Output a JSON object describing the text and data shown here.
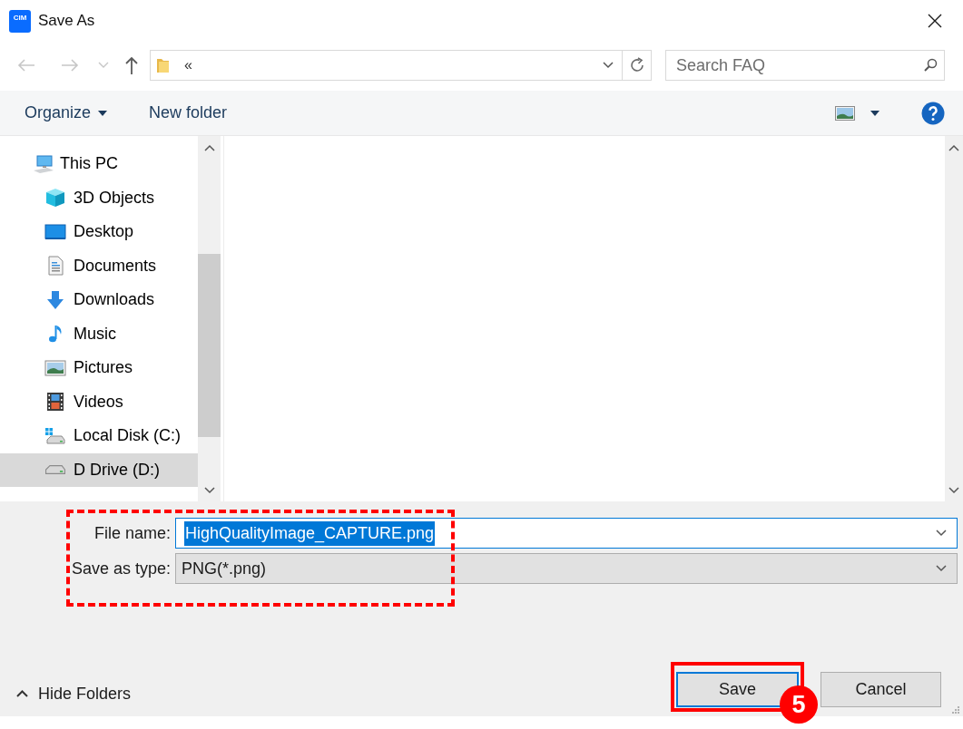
{
  "window": {
    "app_icon_text": "CIM",
    "title": "Save As"
  },
  "nav_buttons": [
    {
      "kind": "back",
      "disabled": true
    },
    {
      "kind": "forward",
      "disabled": true
    },
    {
      "kind": "recent",
      "disabled": true
    },
    {
      "kind": "up",
      "disabled": false
    }
  ],
  "address_bar": {
    "path": "«"
  },
  "search": {
    "placeholder": "Search FAQ"
  },
  "toolbar": {
    "organize": "Organize",
    "new_folder": "New folder"
  },
  "sidebar": {
    "items": [
      {
        "label": "This PC",
        "kind": "pc",
        "selected": false,
        "children": [
          {
            "label": "3D Objects",
            "kind": "objects3d",
            "selected": false
          },
          {
            "label": "Desktop",
            "kind": "desktop",
            "selected": false
          },
          {
            "label": "Documents",
            "kind": "documents",
            "selected": false
          },
          {
            "label": "Downloads",
            "kind": "downloads",
            "selected": false
          },
          {
            "label": "Music",
            "kind": "music",
            "selected": false
          },
          {
            "label": "Pictures",
            "kind": "pictures",
            "selected": false
          },
          {
            "label": "Videos",
            "kind": "videos",
            "selected": false
          },
          {
            "label": "Local Disk (C:)",
            "kind": "localdisk",
            "selected": false
          },
          {
            "label": "D Drive (D:)",
            "kind": "drive",
            "selected": true
          }
        ]
      }
    ]
  },
  "form": {
    "file_name": {
      "label": "File name:",
      "value": "HighQualityImage_CAPTURE.png",
      "selected": true
    },
    "save_as_type": {
      "label": "Save as type:",
      "value": "PNG(*.png)"
    }
  },
  "footer": {
    "hide_folders": "Hide Folders",
    "buttons": [
      {
        "label": "Save",
        "default": true
      },
      {
        "label": "Cancel",
        "default": false
      }
    ]
  },
  "annotation": {
    "step_badge": "5"
  }
}
